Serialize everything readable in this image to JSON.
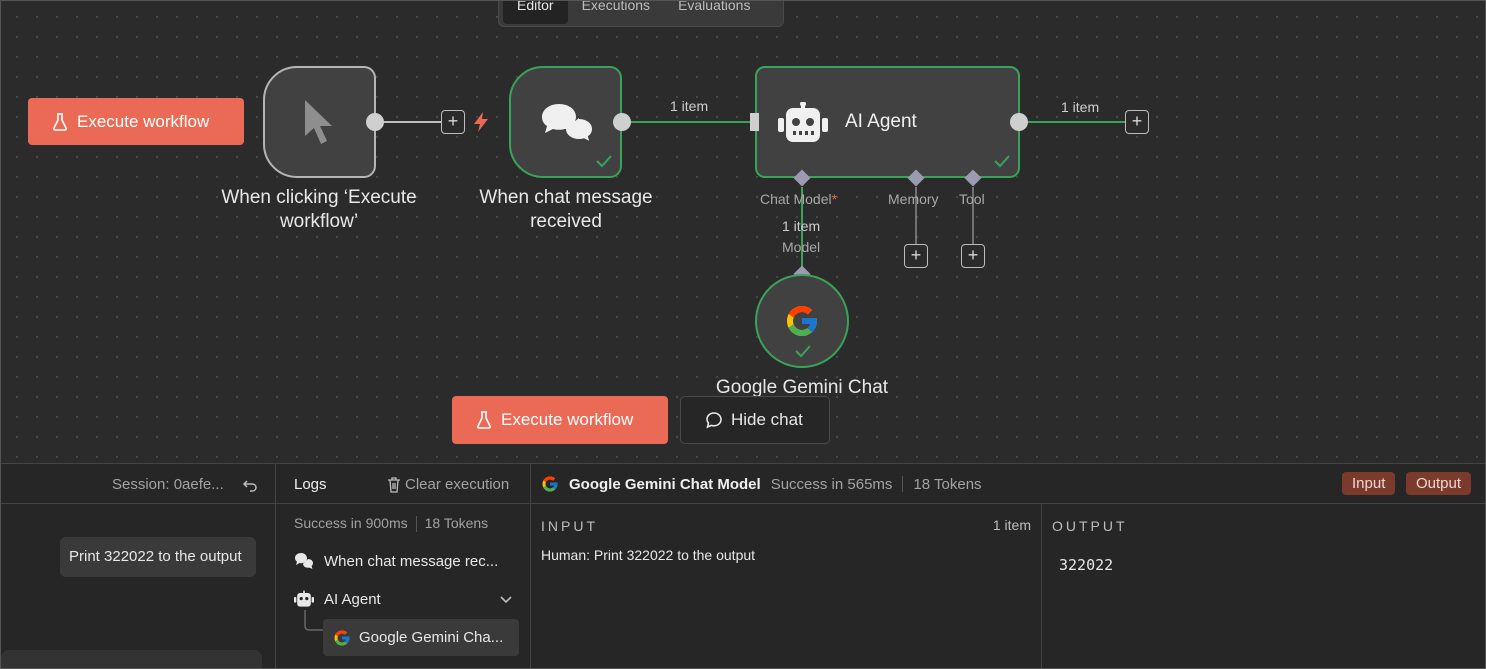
{
  "top_tabs": [
    "Editor",
    "Executions",
    "Evaluations"
  ],
  "execute_button_label": "Execute workflow",
  "hide_chat_label": "Hide chat",
  "nodes": {
    "manual_trigger": {
      "label_line1": "When clicking ‘Execute",
      "label_line2": "workflow’"
    },
    "chat_trigger": {
      "label_line1": "When chat message",
      "label_line2": "received"
    },
    "agent": {
      "title": "AI Agent"
    },
    "gemini": {
      "title": "Google Gemini Chat"
    }
  },
  "connections": {
    "chat_to_agent_items": "1 item",
    "agent_out_items": "1 item",
    "model_items": "1 item",
    "model_label": "Model"
  },
  "agent_ports": {
    "chat_model": "Chat Model",
    "required_mark": "*",
    "memory": "Memory",
    "tool": "Tool"
  },
  "chat_pane": {
    "session": "Session: 0aefe...",
    "message": "Print 322022 to the output"
  },
  "logs_pane": {
    "title": "Logs",
    "clear_label": "Clear execution",
    "status": "Success in 900ms",
    "tokens": "18 Tokens",
    "items": [
      {
        "label": "When chat message rec...",
        "icon": "chat-icon"
      },
      {
        "label": "AI Agent",
        "icon": "robot-icon"
      },
      {
        "label": "Google Gemini Cha...",
        "icon": "google-icon"
      }
    ]
  },
  "detail_pane": {
    "node_name": "Google Gemini Chat Model",
    "status": "Success in 565ms",
    "tokens": "18 Tokens",
    "input_tab": "Input",
    "output_tab": "Output",
    "input_title": "INPUT",
    "input_count": "1 item",
    "input_text": "Human: Print 322022 to the output",
    "output_title": "OUTPUT",
    "output_text": "322022"
  },
  "colors": {
    "accent": "#ea6a55",
    "success": "#3aa35a",
    "canvas": "#2b2b2b",
    "badge": "#7a3a2c"
  }
}
